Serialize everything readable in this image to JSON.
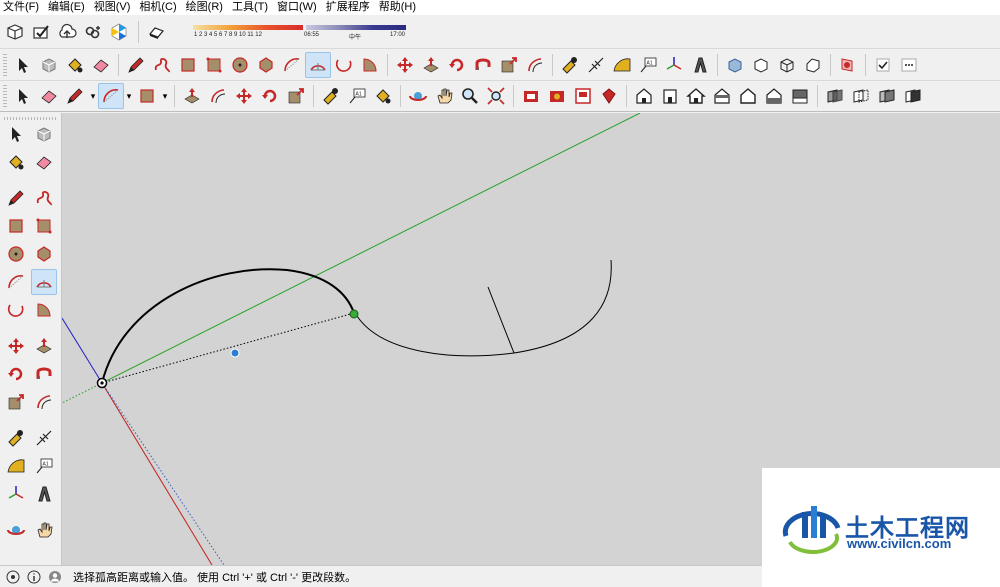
{
  "menubar": {
    "items": [
      "文件(F)",
      "编辑(E)",
      "视图(V)",
      "相机(C)",
      "绘图(R)",
      "工具(T)",
      "窗口(W)",
      "扩展程序",
      "帮助(H)"
    ]
  },
  "shadow": {
    "ticks": "1 2 3 4 5 6 7 8 9 10 11 12",
    "time_start": "06:55",
    "time_mid": "中午",
    "time_end": "17:00"
  },
  "toolbar": {
    "row1_icons": [
      "component-box-icon",
      "send-icon",
      "cloud-upload-icon",
      "link-icon",
      "trimble-icon"
    ],
    "row2_icons": [
      "select-icon",
      "make-component-icon",
      "paint-bucket-icon",
      "eraser-icon",
      "pencil-icon",
      "freehand-icon",
      "rectangle-icon",
      "rotated-rectangle-icon",
      "circle-icon",
      "polygon-icon",
      "arc-icon",
      "two-point-arc-icon",
      "three-point-arc-icon",
      "pie-icon",
      "move-icon",
      "push-pull-icon",
      "rotate-icon",
      "follow-me-icon",
      "scale-icon",
      "offset-icon",
      "tape-measure-icon",
      "dimension-icon",
      "protractor-icon",
      "text-icon",
      "axes-icon",
      "3d-text-icon",
      "box-shaded-icon",
      "box-outline-icon",
      "box-wire-icon",
      "box-white-icon",
      "section-plane-icon",
      "checkbox-icon",
      "more-icon"
    ],
    "row3_icons": [
      "select-icon",
      "eraser-icon",
      "pencil-icon",
      "arc-icon",
      "rectangle-icon",
      "push-pull-icon",
      "offset-icon",
      "move-icon",
      "rotate-icon",
      "scale-icon",
      "tape-measure-icon",
      "text-icon",
      "paint-bucket-icon",
      "orbit-icon",
      "pan-icon",
      "zoom-icon",
      "zoom-extents-icon",
      "warehouse-icon",
      "extension-warehouse-icon",
      "layout-icon",
      "ruby-icon",
      "iso-view-icon",
      "front-view-icon",
      "home-icon",
      "right-view-icon",
      "back-view-icon",
      "left-view-icon",
      "top-view-icon",
      "xray-icon",
      "back-edges-icon",
      "wireframe-icon",
      "shaded-icon"
    ]
  },
  "left_toolbar": {
    "icons": [
      "select-icon",
      "make-component-icon",
      "paint-bucket-icon",
      "eraser-icon",
      "pencil-icon",
      "freehand-icon",
      "rectangle-icon",
      "rotated-rectangle-icon",
      "circle-icon",
      "polygon-icon",
      "arc-icon",
      "two-point-arc-icon",
      "three-point-arc-icon",
      "pie-icon",
      "move-icon",
      "push-pull-icon",
      "rotate-icon",
      "follow-me-icon",
      "scale-icon",
      "offset-icon",
      "tape-measure-icon",
      "dimension-icon",
      "protractor-icon",
      "text-icon",
      "axes-icon",
      "3d-text-icon",
      "orbit-icon",
      "pan-icon",
      "zoom-icon",
      "zoom-window-icon"
    ]
  },
  "statusbar": {
    "text": "选择孤高距离或输入值。 使用 Ctrl '+' 或 Ctrl '-' 更改段数。"
  },
  "watermark": {
    "title": "土木工程网",
    "url": "www.civilcn.com"
  },
  "colors": {
    "viewport": "#d3d3d3",
    "axis_green": "#2aa02a",
    "axis_red": "#c42020",
    "axis_blue": "#2020c0",
    "watermark_blue": "#1a56a8",
    "selected_tool": "#cfe4f7"
  }
}
